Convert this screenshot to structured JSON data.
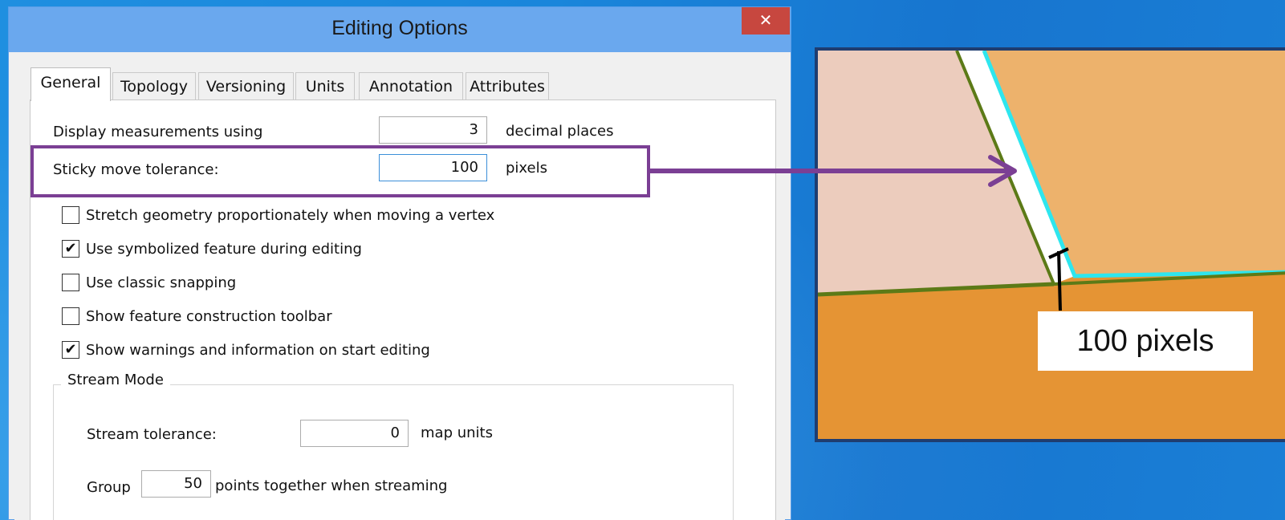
{
  "dialog": {
    "title": "Editing Options",
    "close_icon": "close-icon",
    "close_glyph": "✕"
  },
  "tabs": [
    {
      "label": "General",
      "active": true
    },
    {
      "label": "Topology",
      "active": false
    },
    {
      "label": "Versioning",
      "active": false
    },
    {
      "label": "Units",
      "active": false
    },
    {
      "label": "Annotation",
      "active": false
    },
    {
      "label": "Attributes",
      "active": false
    }
  ],
  "general": {
    "display_measurements": {
      "label": "Display measurements using",
      "value": "3",
      "unit": "decimal places"
    },
    "sticky_move": {
      "label": "Sticky move tolerance:",
      "value": "100",
      "unit": "pixels"
    },
    "checkboxes": [
      {
        "label": "Stretch geometry proportionately when moving a vertex",
        "checked": false
      },
      {
        "label": "Use symbolized feature during editing",
        "checked": true
      },
      {
        "label": "Use classic snapping",
        "checked": false
      },
      {
        "label": "Show feature construction toolbar",
        "checked": false
      },
      {
        "label": "Show warnings and information on start editing",
        "checked": true
      }
    ],
    "check_glyph": "✔",
    "stream_mode": {
      "title": "Stream Mode",
      "tolerance": {
        "label": "Stream tolerance:",
        "value": "0",
        "unit": "map units"
      },
      "group": {
        "label": "Group",
        "value": "50",
        "suffix": "points together when streaming"
      }
    }
  },
  "callout": {
    "map_label": "100 pixels",
    "highlight_color": "#7b3f94"
  },
  "colors": {
    "title_bar": "#6aa8ee",
    "close_button": "#c7473f",
    "parcel_left": "#ecccbd",
    "parcel_right": "#edb26c",
    "parcel_bottom": "#e59434",
    "boundary": "#5c7a17",
    "snap_line": "#2ee6ee"
  }
}
